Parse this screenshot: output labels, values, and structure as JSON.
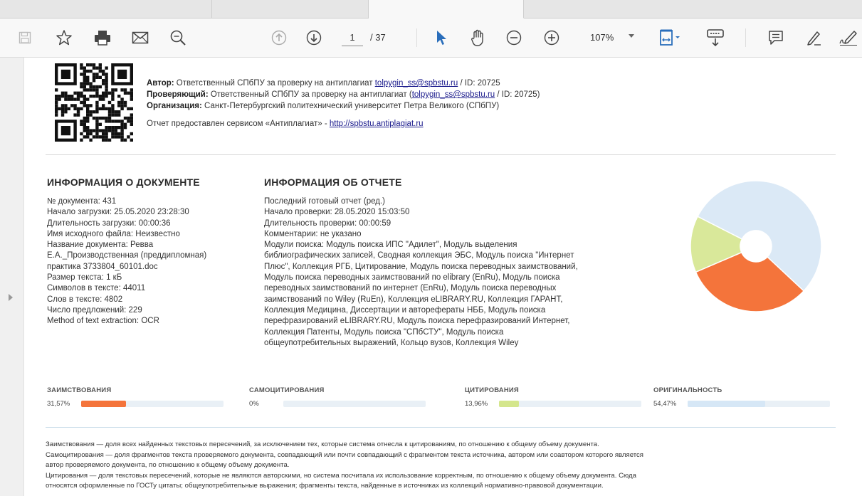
{
  "toolbar": {
    "page_current": "1",
    "page_total": "/ 37",
    "zoom": "107%",
    "icons": [
      "save-icon",
      "bookmark-star-icon",
      "print-icon",
      "email-icon",
      "search-zoom-icon",
      "page-up-icon",
      "page-down-icon",
      "select-pointer-icon",
      "hand-tool-icon",
      "zoom-out-icon",
      "zoom-in-icon",
      "fit-page-icon",
      "scroll-mode-icon",
      "comment-icon",
      "highlight-pen-icon",
      "sign-icon"
    ]
  },
  "header": {
    "author_label": "Автор:",
    "author_text": " Ответственный СПбПУ за проверку на антиплагиат ",
    "author_email": "tolpygin_ss@spbstu.ru",
    "author_id": " / ID: 20725",
    "reviewer_label": "Проверяющий:",
    "reviewer_text": " Ответственный СПбПУ за проверку на антиплагиат (",
    "reviewer_email": "tolpygin_ss@spbstu.ru",
    "reviewer_id": " / ID: 20725)",
    "org_label": "Организация:",
    "org_text": " Санкт-Петербургский политехнический университет Петра Великого (СПбПУ)",
    "service_text": "Отчет предоставлен сервисом «Антиплагиат» - ",
    "service_link": "http://spbstu.antiplagiat.ru"
  },
  "doc_info": {
    "title": "ИНФОРМАЦИЯ О ДОКУМЕНТЕ",
    "lines": [
      "№ документа: 431",
      "Начало загрузки: 25.05.2020 23:28:30",
      "Длительность загрузки: 00:00:36",
      "Имя исходного файла: Неизвестно",
      "Название документа: Ревва",
      "Е.А._Производственная (преддипломная)",
      "практика 3733804_60101.doc",
      "Размер текста: 1 кБ",
      "Символов в тексте: 44011",
      "Слов в тексте: 4802",
      "Число предложений: 229",
      "Method of text extraction: OCR"
    ]
  },
  "report_info": {
    "title": "ИНФОРМАЦИЯ ОБ ОТЧЕТЕ",
    "lines": [
      "Последний готовый отчет (ред.)",
      "Начало проверки: 28.05.2020 15:03:50",
      "Длительность проверки: 00:00:59",
      "Комментарии: не указано",
      "Модули поиска: Модуль поиска ИПС \"Адилет\", Модуль выделения",
      "библиографических записей, Сводная коллекция ЭБС, Модуль поиска \"Интернет",
      "Плюс\", Коллекция РГБ, Цитирование, Модуль поиска переводных заимствований,",
      "Модуль поиска переводных заимствований по elibrary (EnRu), Модуль поиска",
      "переводных заимствований по интернет (EnRu), Модуль поиска переводных",
      "заимствований по Wiley (RuEn), Коллекция eLIBRARY.RU, Коллекция ГАРАНТ,",
      "Коллекция Медицина, Диссертации и авторефераты НББ, Модуль поиска",
      "перефразирований eLIBRARY.RU, Модуль поиска перефразирований Интернет,",
      "Коллекция Патенты, Модуль поиска \"СПбСТУ\", Модуль поиска",
      "общеупотребительных выражений, Кольцо вузов, Коллекция Wiley"
    ]
  },
  "chart_data": {
    "type": "pie",
    "categories": [
      "Заимствования",
      "Самоцитирования",
      "Цитирования",
      "Оригинальность"
    ],
    "values": [
      31.57,
      0,
      13.96,
      54.47
    ],
    "colors": [
      "#f4743b",
      "#7cb5ec",
      "#d9e89a",
      "#dbe9f6"
    ]
  },
  "metrics": [
    {
      "label": "ЗАИМСТВОВАНИЯ",
      "value": "31,57%",
      "fraction": 0.3157,
      "color": "#f4743b"
    },
    {
      "label": "САМОЦИТИРОВАНИЯ",
      "value": "0%",
      "fraction": 0,
      "color": "#7cb5ec"
    },
    {
      "label": "ЦИТИРОВАНИЯ",
      "value": "13,96%",
      "fraction": 0.1396,
      "color": "#d4e68c"
    },
    {
      "label": "ОРИГИНАЛЬНОСТЬ",
      "value": "54,47%",
      "fraction": 0.5447,
      "color": "#d6e7f6"
    }
  ],
  "footer": {
    "lines": [
      "Заимствования — доля всех найденных текстовых пересечений, за исключением тех, которые система отнесла к цитированиям, по отношению к общему объему документа.",
      "Самоцитирования — доля фрагментов текста проверяемого документа, совпадающий или почти совпадающий с фрагментом текста источника, автором или соавтором которого является",
      "автор проверяемого документа, по отношению к общему объему документа.",
      "Цитирования — доля текстовых пересечений, которые не являются авторскими, но система посчитала их использование корректным, по отношению к общему объему документа. Сюда",
      "относятся оформленные по ГОСТу цитаты; общеупотребительные выражения; фрагменты текста, найденные в источниках из коллекций нормативно-правовой документации."
    ]
  }
}
